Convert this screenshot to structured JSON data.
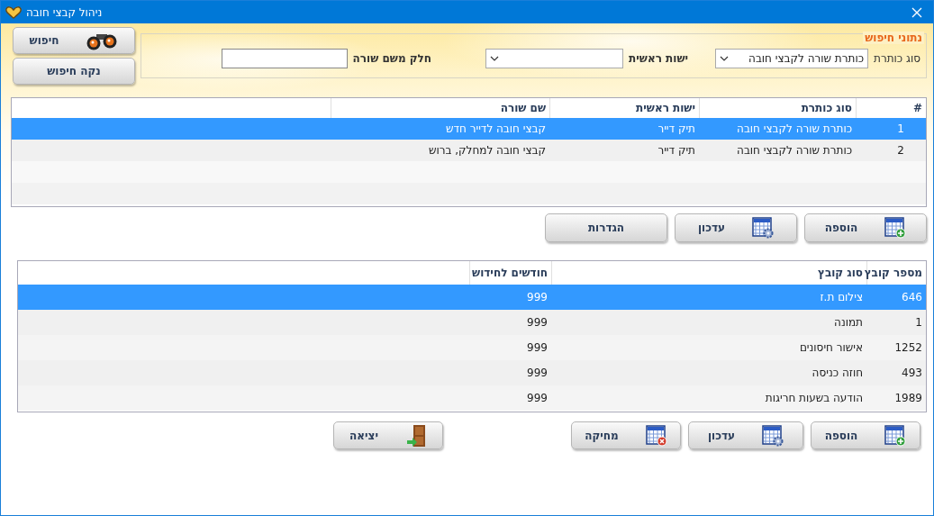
{
  "window": {
    "title": "ניהול קבצי חובה"
  },
  "search": {
    "legend": "נתוני חיפוש",
    "fields": [
      {
        "kind": "select",
        "label": "סוג כותרת",
        "value": "כותרת שורה לקבצי חובה"
      },
      {
        "kind": "select",
        "label": "ישות ראשית"
      },
      {
        "kind": "text",
        "label": "חלק משם שורה"
      }
    ],
    "buttons": [
      {
        "kind": "search",
        "label": "חיפוש"
      },
      {
        "kind": "plain",
        "label": "נקה חיפוש"
      }
    ]
  },
  "headers_table": {
    "columns": [
      "#",
      "סוג כותרת",
      "ישות ראשית",
      "שם שורה"
    ],
    "rows": [
      {
        "cells": [
          "1",
          "כותרת שורה לקבצי חובה",
          "תיק דייר",
          "קבצי חובה לדייר חדש"
        ],
        "selected": true
      },
      {
        "cells": [
          "2",
          "כותרת שורה לקבצי חובה",
          "תיק דייר",
          "קבצי חובה למחלק, ברוש"
        ],
        "selected": false
      }
    ]
  },
  "headers_buttons": [
    {
      "kind": "add",
      "label": "הוספה"
    },
    {
      "kind": "edit",
      "label": "עדכון"
    },
    {
      "kind": "plain",
      "label": "הגדרות"
    }
  ],
  "files_table": {
    "columns": [
      "מספר קובץ",
      "סוג קובץ",
      "חודשים לחידוש"
    ],
    "rows": [
      {
        "cells": [
          "646",
          "צילום ת.ז",
          "999"
        ],
        "selected": true
      },
      {
        "cells": [
          "1",
          "תמונה",
          "999"
        ],
        "selected": false
      },
      {
        "cells": [
          "1252",
          "אישור חיסונים",
          "999"
        ],
        "selected": false
      },
      {
        "cells": [
          "493",
          "חוזה כניסה",
          "999"
        ],
        "selected": false
      },
      {
        "cells": [
          "1989",
          "הודעה בשעות חריגות",
          "999"
        ],
        "selected": false
      }
    ]
  },
  "files_buttons": [
    {
      "kind": "add",
      "label": "הוספה"
    },
    {
      "kind": "edit",
      "label": "עדכון"
    },
    {
      "kind": "delete",
      "label": "מחיקה"
    },
    {
      "kind": "exit",
      "label": "יציאה"
    }
  ]
}
